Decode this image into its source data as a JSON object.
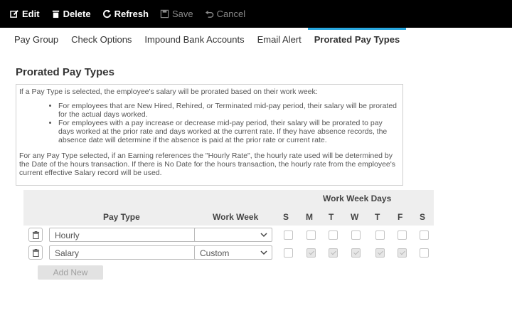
{
  "toolbar": {
    "edit_label": "Edit",
    "delete_label": "Delete",
    "refresh_label": "Refresh",
    "save_label": "Save",
    "cancel_label": "Cancel"
  },
  "tabs": [
    {
      "label": "Pay Group"
    },
    {
      "label": "Check Options"
    },
    {
      "label": "Impound Bank Accounts"
    },
    {
      "label": "Email Alert"
    },
    {
      "label": "Prorated Pay Types",
      "active": true
    }
  ],
  "section": {
    "title": "Prorated Pay Types"
  },
  "info": {
    "intro": "If a Pay Type is selected, the employee's salary will be prorated based on their work week:",
    "bullets": [
      "For employees that are New Hired, Rehired, or Terminated mid-pay period, their salary will be prorated for the actual days worked.",
      "For employees with a pay increase or decrease mid-pay period, their salary will be prorated to pay days worked at the prior rate and days worked at the current rate. If they have absence records, the absence date will determine if the absence is paid at the prior rate or current rate."
    ],
    "footer": "For any Pay Type selected, if an Earning references the \"Hourly Rate\", the hourly rate used will be determined by the Date of the hours transaction. If there is No Date for the hours transaction, the hourly rate from the employee's current effective Salary record will be used."
  },
  "table": {
    "group_header": "Work Week Days",
    "col_pay_type": "Pay Type",
    "col_work_week": "Work Week",
    "days": [
      "S",
      "M",
      "T",
      "W",
      "T",
      "F",
      "S"
    ],
    "rows": [
      {
        "pay_type": "Hourly",
        "work_week": "",
        "days_checked": [
          false,
          false,
          false,
          false,
          false,
          false,
          false
        ]
      },
      {
        "pay_type": "Salary",
        "work_week": "Custom",
        "days_checked": [
          false,
          true,
          true,
          true,
          true,
          true,
          false
        ]
      }
    ]
  },
  "add_new_label": "Add New",
  "colors": {
    "accent": "#29a8e0",
    "toolbar_bg": "#000000",
    "table_header_bg": "#eeeeee"
  }
}
